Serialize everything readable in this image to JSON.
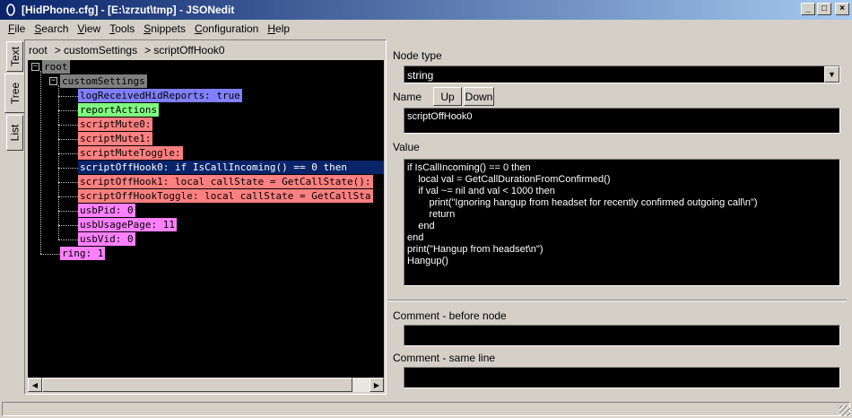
{
  "window": {
    "title": "[HidPhone.cfg] - [E:\\zrzut\\tmp] - JSONedit",
    "minimize_glyph": "_",
    "maximize_glyph": "□",
    "close_glyph": "×"
  },
  "menu": [
    {
      "first": "F",
      "rest": "ile"
    },
    {
      "first": "S",
      "rest": "earch"
    },
    {
      "first": "V",
      "rest": "iew"
    },
    {
      "first": "T",
      "rest": "ools"
    },
    {
      "first": "S",
      "rest": "nippets"
    },
    {
      "first": "C",
      "rest": "onfiguration"
    },
    {
      "first": "H",
      "rest": "elp"
    }
  ],
  "side_tabs": [
    "Text",
    "Tree",
    "List"
  ],
  "breadcrumb": [
    "root",
    "> customSettings",
    "> scriptOffHook0"
  ],
  "tree": [
    {
      "label": "root",
      "color": "#808080"
    },
    {
      "label": "customSettings",
      "color": "#808080"
    },
    {
      "label": "logReceivedHidReports: true",
      "color": "#8080ff"
    },
    {
      "label": "reportActions",
      "color": "#80ff80"
    },
    {
      "label": "scriptMute0:",
      "color": "#ff8080"
    },
    {
      "label": "scriptMute1:",
      "color": "#ff8080"
    },
    {
      "label": "scriptMuteToggle:",
      "color": "#ff8080"
    },
    {
      "label": "scriptOffHook0: if IsCallIncoming() == 0 then",
      "color": "#0a246a"
    },
    {
      "label": "scriptOffHook1: local callState = GetCallState():",
      "color": "#ff8080"
    },
    {
      "label": "scriptOffHookToggle: local callState = GetCallSta",
      "color": "#ff8080"
    },
    {
      "label": "usbPid: 0",
      "color": "#ff80ff"
    },
    {
      "label": "usbUsagePage: 11",
      "color": "#ff80ff"
    },
    {
      "label": "usbVid: 0",
      "color": "#ff80ff"
    },
    {
      "label": "ring: 1",
      "color": "#ff80ff"
    }
  ],
  "tree_glyphs": {
    "expander": "−",
    "scroll_left": "◀",
    "scroll_right": "▶"
  },
  "right": {
    "node_type_label": "Node type",
    "node_type_value": "string",
    "combo_arrow": "▼",
    "name_label": "Name",
    "up_button": "Up",
    "down_button": "Down",
    "name_value": "scriptOffHook0",
    "value_label": "Value",
    "value_code": "if IsCallIncoming() == 0 then\n    local val = GetCallDurationFromConfirmed()\n    if val ~= nil and val < 1000 then\n        print(\"Ignoring hangup from headset for recently confirmed outgoing call\\n\")\n        return\n    end\nend\nprint(\"Hangup from headset\\n\")\nHangup()",
    "comment_before_label": "Comment - before node",
    "comment_before_value": "",
    "comment_same_label": "Comment - same line",
    "comment_same_value": ""
  }
}
